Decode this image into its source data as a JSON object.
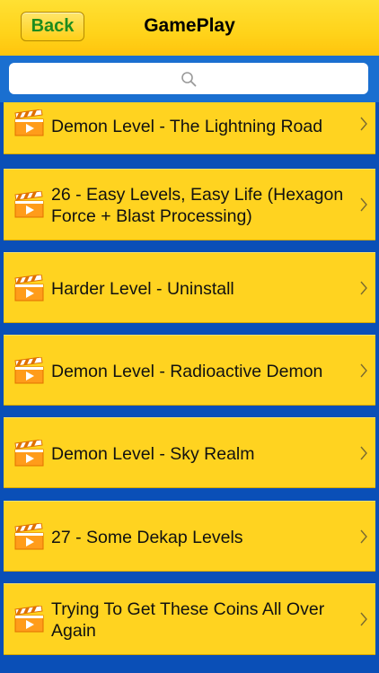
{
  "nav": {
    "back_label": "Back",
    "title": "GamePlay"
  },
  "search": {
    "icon": "search-icon"
  },
  "items": [
    {
      "label": "Demon Level - The Lightning Road",
      "icon": "video-clapperboard-icon"
    },
    {
      "label": "26 - Easy Levels, Easy Life (Hexagon Force + Blast Processing)",
      "icon": "video-clapperboard-icon"
    },
    {
      "label": "Harder Level - Uninstall",
      "icon": "video-clapperboard-icon"
    },
    {
      "label": "Demon Level - Radioactive Demon",
      "icon": "video-clapperboard-icon"
    },
    {
      "label": "Demon Level - Sky Realm",
      "icon": "video-clapperboard-icon"
    },
    {
      "label": "27 - Some Dekap Levels",
      "icon": "video-clapperboard-icon"
    },
    {
      "label": "Trying To Get These Coins All Over Again",
      "icon": "video-clapperboard-icon"
    }
  ],
  "colors": {
    "nav_yellow": "#ffd31a",
    "row_yellow": "#ffd320",
    "list_blue": "#0a4fb7",
    "back_text_green": "#1e8c1e"
  }
}
